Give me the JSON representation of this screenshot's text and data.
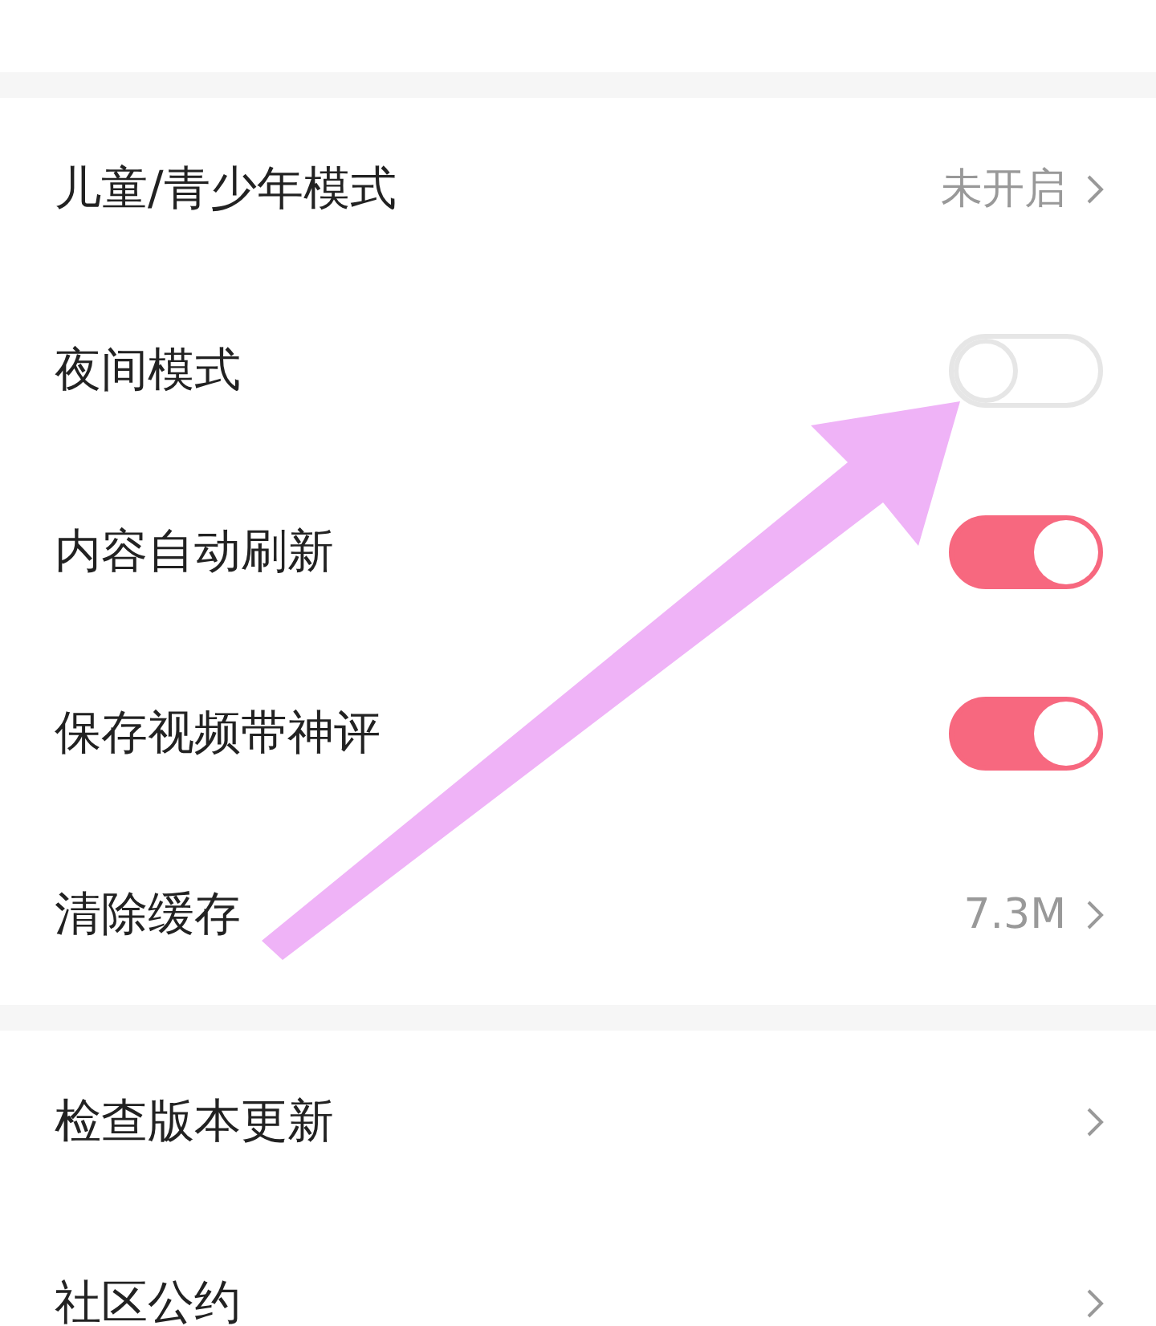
{
  "sections": [
    {
      "rows": [
        {
          "kind": "link",
          "label": "儿童/青少年模式",
          "value": "未开启"
        },
        {
          "kind": "toggle",
          "label": "夜间模式",
          "on": false
        },
        {
          "kind": "toggle",
          "label": "内容自动刷新",
          "on": true
        },
        {
          "kind": "toggle",
          "label": "保存视频带神评",
          "on": true
        },
        {
          "kind": "link",
          "label": "清除缓存",
          "value": "7.3M"
        }
      ]
    },
    {
      "rows": [
        {
          "kind": "link",
          "label": "检查版本更新"
        },
        {
          "kind": "link",
          "label": "社区公约"
        }
      ]
    }
  ]
}
